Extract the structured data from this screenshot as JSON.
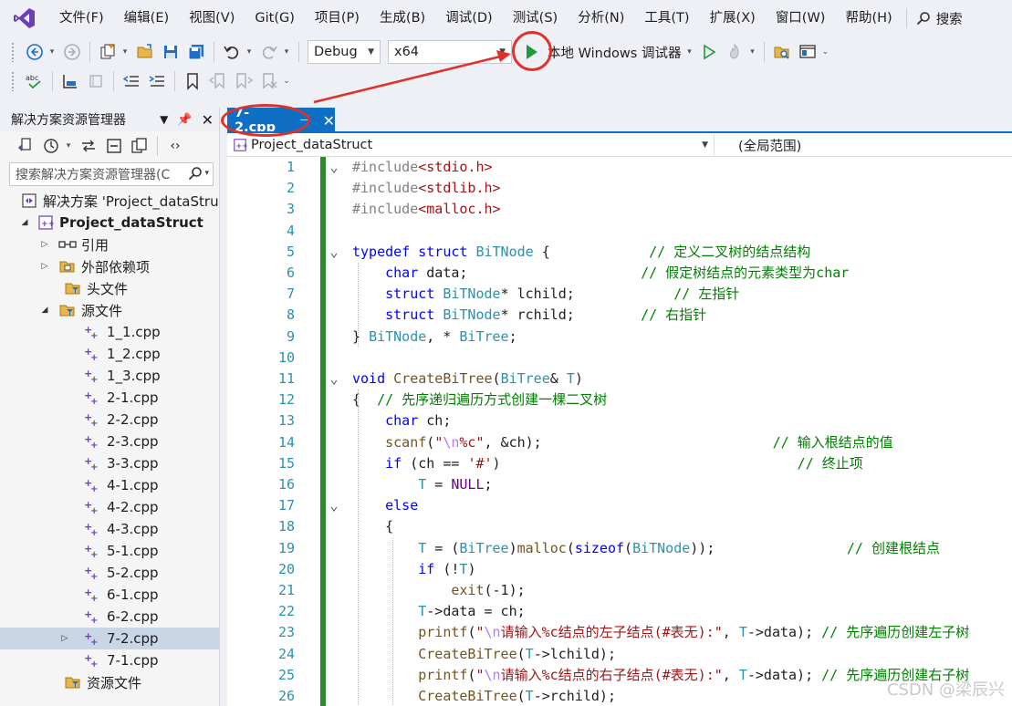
{
  "menu": [
    "文件(F)",
    "编辑(E)",
    "视图(V)",
    "Git(G)",
    "项目(P)",
    "生成(B)",
    "调试(D)",
    "测试(S)",
    "分析(N)",
    "工具(T)",
    "扩展(X)",
    "窗口(W)",
    "帮助(H)"
  ],
  "search_label": "搜索",
  "toolbar": {
    "config": "Debug",
    "platform": "x64",
    "run_label": "本地 Windows 调试器"
  },
  "solution_explorer": {
    "title": "解决方案资源管理器",
    "search_placeholder": "搜索解决方案资源管理器(C",
    "solution": "解决方案 'Project_dataStru",
    "project": "Project_dataStruct",
    "references": "引用",
    "external_deps": "外部依赖项",
    "headers": "头文件",
    "sources": "源文件",
    "files": [
      "1_1.cpp",
      "1_2.cpp",
      "1_3.cpp",
      "2-1.cpp",
      "2-2.cpp",
      "2-3.cpp",
      "3-3.cpp",
      "4-1.cpp",
      "4-2.cpp",
      "4-3.cpp",
      "5-1.cpp",
      "5-2.cpp",
      "6-1.cpp",
      "6-2.cpp",
      "7-2.cpp",
      "7-1.cpp"
    ],
    "selected_file": "7-2.cpp",
    "resources": "资源文件"
  },
  "editor": {
    "tab": "7-2.cpp",
    "project_combo": "Project_dataStruct",
    "scope_combo": "(全局范围)",
    "code": [
      {
        "n": "1",
        "f": "v",
        "tk": [
          [
            "pp",
            "#include"
          ],
          [
            "s",
            "<stdio.h>"
          ]
        ]
      },
      {
        "n": "2",
        "f": "",
        "tk": [
          [
            "pp",
            "#include"
          ],
          [
            "s",
            "<stdlib.h>"
          ]
        ]
      },
      {
        "n": "3",
        "f": "",
        "tk": [
          [
            "pp",
            "#include"
          ],
          [
            "s",
            "<malloc.h>"
          ]
        ]
      },
      {
        "n": "4",
        "f": "",
        "tk": []
      },
      {
        "n": "5",
        "f": "v",
        "tk": [
          [
            "k",
            "typedef"
          ],
          [
            "",
            " "
          ],
          [
            "k",
            "struct"
          ],
          [
            "",
            " "
          ],
          [
            "t",
            "BiTNode"
          ],
          [
            "",
            " {            "
          ],
          [
            "c",
            "// 定义二叉树的结点结构"
          ]
        ]
      },
      {
        "n": "6",
        "f": "",
        "tk": [
          [
            "",
            "    "
          ],
          [
            "k",
            "char"
          ],
          [
            "",
            " data;                     "
          ],
          [
            "c",
            "// 假定树结点的元素类型为char"
          ]
        ]
      },
      {
        "n": "7",
        "f": "",
        "tk": [
          [
            "",
            "    "
          ],
          [
            "k",
            "struct"
          ],
          [
            "",
            " "
          ],
          [
            "t",
            "BiTNode"
          ],
          [
            "",
            "* lchild;            "
          ],
          [
            "c",
            "// 左指针"
          ]
        ]
      },
      {
        "n": "8",
        "f": "",
        "tk": [
          [
            "",
            "    "
          ],
          [
            "k",
            "struct"
          ],
          [
            "",
            " "
          ],
          [
            "t",
            "BiTNode"
          ],
          [
            "",
            "* rchild;        "
          ],
          [
            "c",
            "// 右指针"
          ]
        ]
      },
      {
        "n": "9",
        "f": "",
        "tk": [
          [
            "",
            "} "
          ],
          [
            "t",
            "BiTNode"
          ],
          [
            "",
            ", * "
          ],
          [
            "t",
            "BiTree"
          ],
          [
            "",
            ";"
          ]
        ]
      },
      {
        "n": "10",
        "f": "",
        "tk": []
      },
      {
        "n": "11",
        "f": "v",
        "tk": [
          [
            "k",
            "void"
          ],
          [
            "",
            " "
          ],
          [
            "fn",
            "CreateBiTree"
          ],
          [
            "",
            "("
          ],
          [
            "t",
            "BiTree"
          ],
          [
            "",
            "& "
          ],
          [
            "t",
            "T"
          ],
          [
            "",
            ")"
          ]
        ]
      },
      {
        "n": "12",
        "f": "",
        "tk": [
          [
            "",
            "{  "
          ],
          [
            "c",
            "// 先序递归遍历方式创建一棵二叉树"
          ]
        ]
      },
      {
        "n": "13",
        "f": "",
        "tk": [
          [
            "",
            "    "
          ],
          [
            "k",
            "char"
          ],
          [
            "",
            " ch;"
          ]
        ]
      },
      {
        "n": "14",
        "f": "",
        "tk": [
          [
            "",
            "    "
          ],
          [
            "fn",
            "scanf"
          ],
          [
            "",
            "("
          ],
          [
            "s",
            "\""
          ],
          [
            "esc",
            "\\n"
          ],
          [
            "s",
            "%c\""
          ],
          [
            "",
            ", &ch);                            "
          ],
          [
            "c",
            "// 输入根结点的值"
          ]
        ]
      },
      {
        "n": "15",
        "f": "",
        "tk": [
          [
            "",
            "    "
          ],
          [
            "k",
            "if"
          ],
          [
            "",
            " (ch == "
          ],
          [
            "s",
            "'#'"
          ],
          [
            "",
            ")                                    "
          ],
          [
            "c",
            "// 终止项"
          ]
        ]
      },
      {
        "n": "16",
        "f": "",
        "tk": [
          [
            "",
            "        "
          ],
          [
            "t",
            "T"
          ],
          [
            "",
            " = "
          ],
          [
            "mac",
            "NULL"
          ],
          [
            "",
            ";"
          ]
        ]
      },
      {
        "n": "17",
        "f": "v",
        "tk": [
          [
            "",
            "    "
          ],
          [
            "k",
            "else"
          ]
        ]
      },
      {
        "n": "18",
        "f": "",
        "tk": [
          [
            "",
            "    {"
          ]
        ]
      },
      {
        "n": "19",
        "f": "",
        "tk": [
          [
            "",
            "        "
          ],
          [
            "t",
            "T"
          ],
          [
            "",
            " = ("
          ],
          [
            "t",
            "BiTree"
          ],
          [
            "",
            ")"
          ],
          [
            "fn",
            "malloc"
          ],
          [
            "",
            "("
          ],
          [
            "k",
            "sizeof"
          ],
          [
            "",
            "("
          ],
          [
            "t",
            "BiTNode"
          ],
          [
            "",
            "));                "
          ],
          [
            "c",
            "// 创建根结点"
          ]
        ]
      },
      {
        "n": "20",
        "f": "",
        "tk": [
          [
            "",
            "        "
          ],
          [
            "k",
            "if"
          ],
          [
            "",
            " (!"
          ],
          [
            "t",
            "T"
          ],
          [
            "",
            ")"
          ]
        ]
      },
      {
        "n": "21",
        "f": "",
        "tk": [
          [
            "",
            "            "
          ],
          [
            "fn",
            "exit"
          ],
          [
            "",
            "(-1);"
          ]
        ]
      },
      {
        "n": "22",
        "f": "",
        "tk": [
          [
            "",
            "        "
          ],
          [
            "t",
            "T"
          ],
          [
            "",
            "->data = ch;"
          ]
        ]
      },
      {
        "n": "23",
        "f": "",
        "tk": [
          [
            "",
            "        "
          ],
          [
            "fn",
            "printf"
          ],
          [
            "",
            "("
          ],
          [
            "s",
            "\""
          ],
          [
            "esc",
            "\\n"
          ],
          [
            "s",
            "请输入%c结点的左子结点(#表无):\""
          ],
          [
            "",
            ", "
          ],
          [
            "t",
            "T"
          ],
          [
            "",
            "->data); "
          ],
          [
            "c",
            "// 先序遍历创建左子树"
          ]
        ]
      },
      {
        "n": "24",
        "f": "",
        "tk": [
          [
            "",
            "        "
          ],
          [
            "fn",
            "CreateBiTree"
          ],
          [
            "",
            "("
          ],
          [
            "t",
            "T"
          ],
          [
            "",
            "->lchild);"
          ]
        ]
      },
      {
        "n": "25",
        "f": "",
        "tk": [
          [
            "",
            "        "
          ],
          [
            "fn",
            "printf"
          ],
          [
            "",
            "("
          ],
          [
            "s",
            "\""
          ],
          [
            "esc",
            "\\n"
          ],
          [
            "s",
            "请输入%c结点的右子结点(#表无):\""
          ],
          [
            "",
            ", "
          ],
          [
            "t",
            "T"
          ],
          [
            "",
            "->data); "
          ],
          [
            "c",
            "// 先序遍历创建右子树"
          ]
        ]
      },
      {
        "n": "26",
        "f": "",
        "tk": [
          [
            "",
            "        "
          ],
          [
            "fn",
            "CreateBiTree"
          ],
          [
            "",
            "("
          ],
          [
            "t",
            "T"
          ],
          [
            "",
            "->rchild);"
          ]
        ]
      }
    ]
  },
  "watermark": "CSDN @梁辰兴",
  "colors": {
    "accent": "#0e6fc4",
    "run_green": "#1e9b3a",
    "annotation_red": "#e0302a",
    "change_bar": "#2b8a2b"
  }
}
